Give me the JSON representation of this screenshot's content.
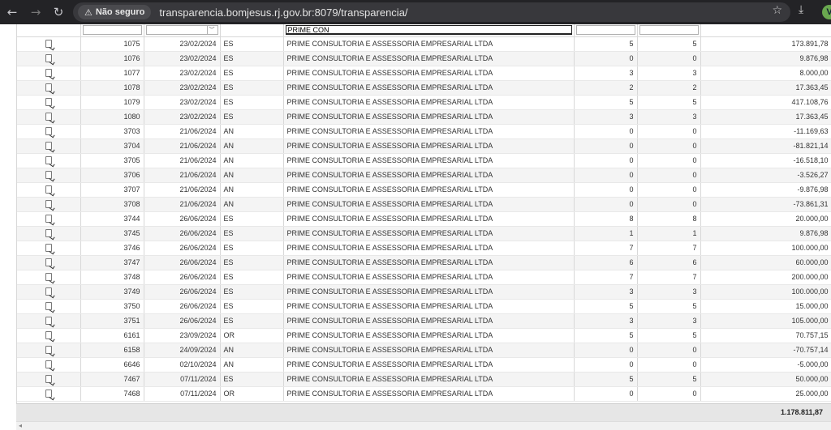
{
  "browser": {
    "security_label": "Não seguro",
    "url": "transparencia.bomjesus.rj.gov.br:8079/transparencia/",
    "profile_initial": "V"
  },
  "filters": {
    "name_value": "PRIME CON"
  },
  "rows": [
    {
      "id": "1075",
      "date": "23/02/2024",
      "type": "ES",
      "name": "PRIME CONSULTORIA E ASSESSORIA EMPRESARIAL LTDA",
      "a": "5",
      "b": "5",
      "value": "173.891,78"
    },
    {
      "id": "1076",
      "date": "23/02/2024",
      "type": "ES",
      "name": "PRIME CONSULTORIA E ASSESSORIA EMPRESARIAL LTDA",
      "a": "0",
      "b": "0",
      "value": "9.876,98"
    },
    {
      "id": "1077",
      "date": "23/02/2024",
      "type": "ES",
      "name": "PRIME CONSULTORIA E ASSESSORIA EMPRESARIAL LTDA",
      "a": "3",
      "b": "3",
      "value": "8.000,00"
    },
    {
      "id": "1078",
      "date": "23/02/2024",
      "type": "ES",
      "name": "PRIME CONSULTORIA E ASSESSORIA EMPRESARIAL LTDA",
      "a": "2",
      "b": "2",
      "value": "17.363,45"
    },
    {
      "id": "1079",
      "date": "23/02/2024",
      "type": "ES",
      "name": "PRIME CONSULTORIA E ASSESSORIA EMPRESARIAL LTDA",
      "a": "5",
      "b": "5",
      "value": "417.108,76"
    },
    {
      "id": "1080",
      "date": "23/02/2024",
      "type": "ES",
      "name": "PRIME CONSULTORIA E ASSESSORIA EMPRESARIAL LTDA",
      "a": "3",
      "b": "3",
      "value": "17.363,45"
    },
    {
      "id": "3703",
      "date": "21/06/2024",
      "type": "AN",
      "name": "PRIME CONSULTORIA E ASSESSORIA EMPRESARIAL LTDA",
      "a": "0",
      "b": "0",
      "value": "-11.169,63"
    },
    {
      "id": "3704",
      "date": "21/06/2024",
      "type": "AN",
      "name": "PRIME CONSULTORIA E ASSESSORIA EMPRESARIAL LTDA",
      "a": "0",
      "b": "0",
      "value": "-81.821,14"
    },
    {
      "id": "3705",
      "date": "21/06/2024",
      "type": "AN",
      "name": "PRIME CONSULTORIA E ASSESSORIA EMPRESARIAL LTDA",
      "a": "0",
      "b": "0",
      "value": "-16.518,10"
    },
    {
      "id": "3706",
      "date": "21/06/2024",
      "type": "AN",
      "name": "PRIME CONSULTORIA E ASSESSORIA EMPRESARIAL LTDA",
      "a": "0",
      "b": "0",
      "value": "-3.526,27"
    },
    {
      "id": "3707",
      "date": "21/06/2024",
      "type": "AN",
      "name": "PRIME CONSULTORIA E ASSESSORIA EMPRESARIAL LTDA",
      "a": "0",
      "b": "0",
      "value": "-9.876,98"
    },
    {
      "id": "3708",
      "date": "21/06/2024",
      "type": "AN",
      "name": "PRIME CONSULTORIA E ASSESSORIA EMPRESARIAL LTDA",
      "a": "0",
      "b": "0",
      "value": "-73.861,31"
    },
    {
      "id": "3744",
      "date": "26/06/2024",
      "type": "ES",
      "name": "PRIME CONSULTORIA E ASSESSORIA EMPRESARIAL LTDA",
      "a": "8",
      "b": "8",
      "value": "20.000,00"
    },
    {
      "id": "3745",
      "date": "26/06/2024",
      "type": "ES",
      "name": "PRIME CONSULTORIA E ASSESSORIA EMPRESARIAL LTDA",
      "a": "1",
      "b": "1",
      "value": "9.876,98"
    },
    {
      "id": "3746",
      "date": "26/06/2024",
      "type": "ES",
      "name": "PRIME CONSULTORIA E ASSESSORIA EMPRESARIAL LTDA",
      "a": "7",
      "b": "7",
      "value": "100.000,00"
    },
    {
      "id": "3747",
      "date": "26/06/2024",
      "type": "ES",
      "name": "PRIME CONSULTORIA E ASSESSORIA EMPRESARIAL LTDA",
      "a": "6",
      "b": "6",
      "value": "60.000,00"
    },
    {
      "id": "3748",
      "date": "26/06/2024",
      "type": "ES",
      "name": "PRIME CONSULTORIA E ASSESSORIA EMPRESARIAL LTDA",
      "a": "7",
      "b": "7",
      "value": "200.000,00"
    },
    {
      "id": "3749",
      "date": "26/06/2024",
      "type": "ES",
      "name": "PRIME CONSULTORIA E ASSESSORIA EMPRESARIAL LTDA",
      "a": "3",
      "b": "3",
      "value": "100.000,00"
    },
    {
      "id": "3750",
      "date": "26/06/2024",
      "type": "ES",
      "name": "PRIME CONSULTORIA E ASSESSORIA EMPRESARIAL LTDA",
      "a": "5",
      "b": "5",
      "value": "15.000,00"
    },
    {
      "id": "3751",
      "date": "26/06/2024",
      "type": "ES",
      "name": "PRIME CONSULTORIA E ASSESSORIA EMPRESARIAL LTDA",
      "a": "3",
      "b": "3",
      "value": "105.000,00"
    },
    {
      "id": "6161",
      "date": "23/09/2024",
      "type": "OR",
      "name": "PRIME CONSULTORIA E ASSESSORIA EMPRESARIAL LTDA",
      "a": "5",
      "b": "5",
      "value": "70.757,15"
    },
    {
      "id": "6158",
      "date": "24/09/2024",
      "type": "AN",
      "name": "PRIME CONSULTORIA E ASSESSORIA EMPRESARIAL LTDA",
      "a": "0",
      "b": "0",
      "value": "-70.757,14"
    },
    {
      "id": "6646",
      "date": "02/10/2024",
      "type": "AN",
      "name": "PRIME CONSULTORIA E ASSESSORIA EMPRESARIAL LTDA",
      "a": "0",
      "b": "0",
      "value": "-5.000,00"
    },
    {
      "id": "7467",
      "date": "07/11/2024",
      "type": "ES",
      "name": "PRIME CONSULTORIA E ASSESSORIA EMPRESARIAL LTDA",
      "a": "5",
      "b": "5",
      "value": "50.000,00"
    },
    {
      "id": "7468",
      "date": "07/11/2024",
      "type": "OR",
      "name": "PRIME CONSULTORIA E ASSESSORIA EMPRESARIAL LTDA",
      "a": "0",
      "b": "0",
      "value": "25.000,00"
    }
  ],
  "footer": {
    "total": "1.178.811,87"
  }
}
